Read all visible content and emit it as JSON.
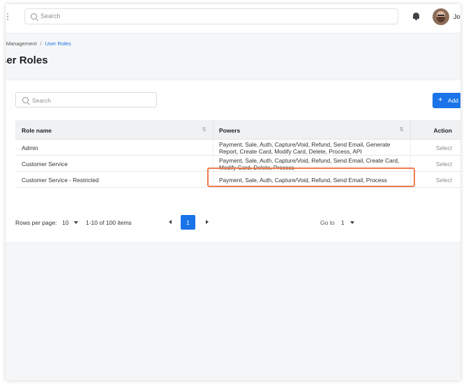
{
  "topbar": {
    "search_placeholder": "Search",
    "user_name": "Jo"
  },
  "breadcrumb": {
    "parent": "er Management",
    "separator": "/",
    "current": "User Roles"
  },
  "page_title": "ser Roles",
  "card": {
    "search_placeholder": "Search",
    "add_label": "Add",
    "add_plus": "+"
  },
  "table": {
    "headers": {
      "role_name": "Role name",
      "powers": "Powers",
      "action": "Action",
      "sort_glyph": "⇅"
    },
    "rows": [
      {
        "role": "Admin",
        "powers": "Payment, Sale, Auth, Capture/Void, Refund, Send Email, Generate Report, Create Card, Modify Card, Delete, Process, API",
        "action": "Select"
      },
      {
        "role": "Customer Service",
        "powers": "Payment, Sale, Auth, Capture/Void, Refund, Send Email, Create Card, Modify Card, Delete, Process",
        "action": "Select"
      },
      {
        "role": "Customer Service - Restricted",
        "powers": "Payment, Sale, Auth, Capture/Void, Refund, Send Email, Process",
        "action": "Select"
      }
    ]
  },
  "pagination": {
    "rows_per_page_label": "Rows per page:",
    "rows_per_page_value": "10",
    "range_text": "1-10 of 100 items",
    "current_page": "1",
    "goto_label": "Go to",
    "goto_value": "1"
  },
  "colors": {
    "accent": "#1a73e8",
    "highlight": "#f07a4f"
  }
}
